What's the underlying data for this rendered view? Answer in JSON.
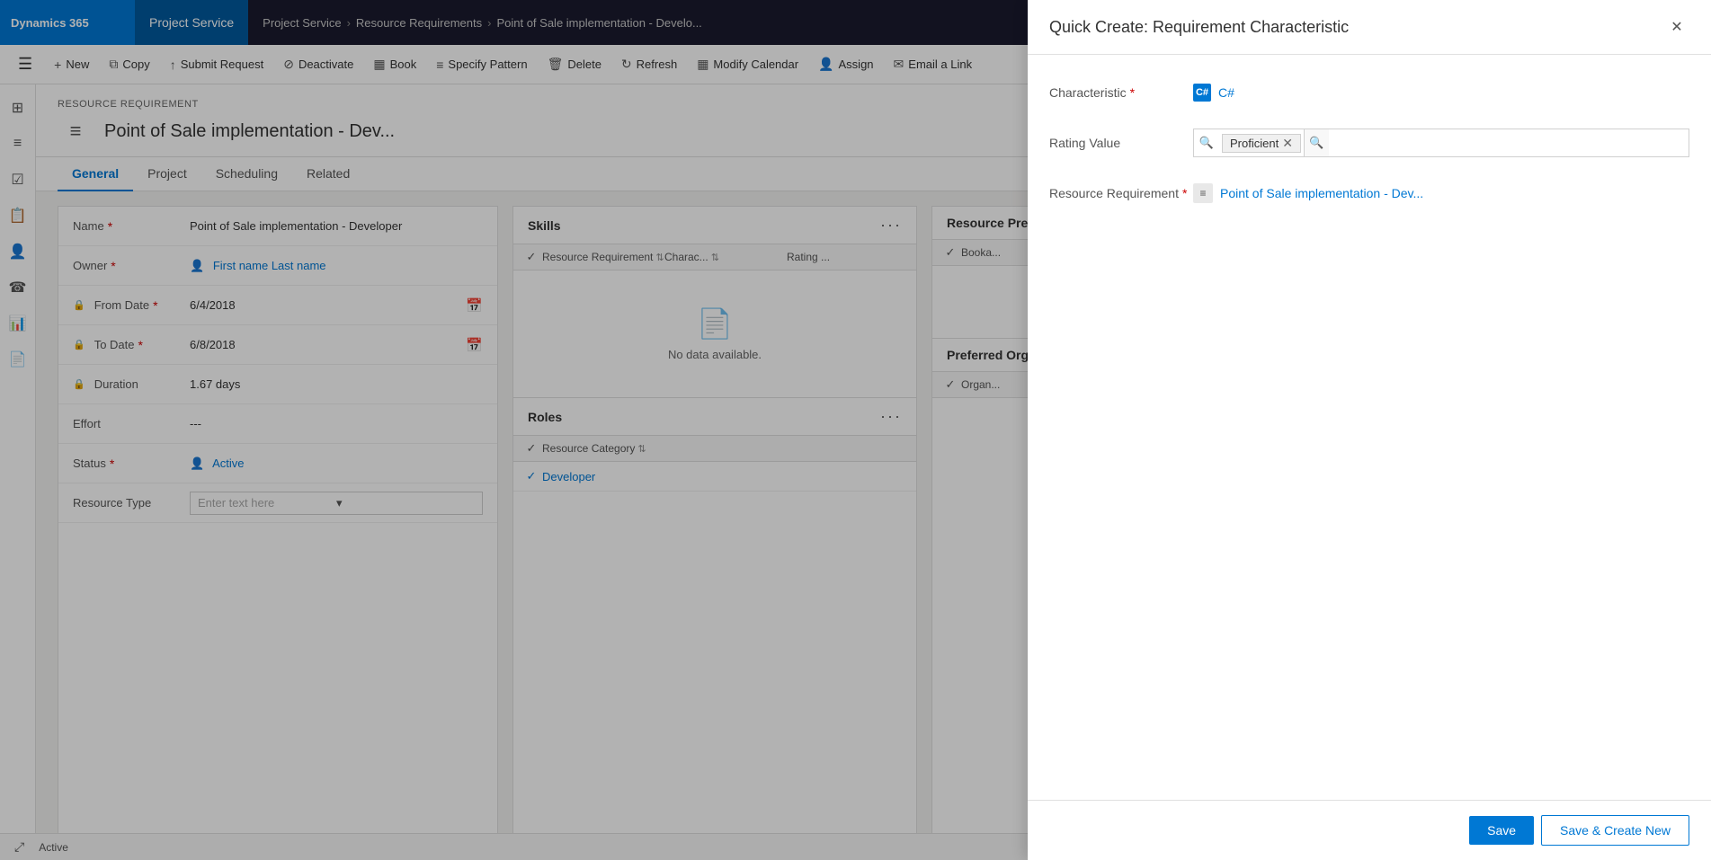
{
  "app": {
    "brand": "Dynamics 365",
    "module": "Project Service"
  },
  "breadcrumb": {
    "items": [
      "Project Service",
      "Resource Requirements",
      "Point of Sale implementation - Develo..."
    ]
  },
  "toolbar": {
    "buttons": [
      {
        "id": "new",
        "label": "New",
        "icon": "+"
      },
      {
        "id": "copy",
        "label": "Copy",
        "icon": "⧉"
      },
      {
        "id": "submit-request",
        "label": "Submit Request",
        "icon": "↑"
      },
      {
        "id": "deactivate",
        "label": "Deactivate",
        "icon": "⊘"
      },
      {
        "id": "book",
        "label": "Book",
        "icon": "▦"
      },
      {
        "id": "specify-pattern",
        "label": "Specify Pattern",
        "icon": "≡"
      },
      {
        "id": "delete",
        "label": "Delete",
        "icon": "🗑"
      },
      {
        "id": "refresh",
        "label": "Refresh",
        "icon": "↻"
      },
      {
        "id": "modify-calendar",
        "label": "Modify Calendar",
        "icon": "▦"
      },
      {
        "id": "assign",
        "label": "Assign",
        "icon": "👤"
      },
      {
        "id": "email-link",
        "label": "Email a Link",
        "icon": "✉"
      }
    ]
  },
  "record": {
    "type": "RESOURCE REQUIREMENT",
    "title": "Point of Sale implementation - Dev...",
    "tabs": [
      "General",
      "Project",
      "Scheduling",
      "Related"
    ],
    "active_tab": "General"
  },
  "form": {
    "fields": [
      {
        "label": "Name",
        "required": true,
        "value": "Point of Sale implementation - Developer",
        "type": "text"
      },
      {
        "label": "Owner",
        "required": true,
        "value": "First name Last name",
        "type": "link",
        "icon": "👤"
      },
      {
        "label": "From Date",
        "required": true,
        "value": "6/4/2018",
        "type": "date"
      },
      {
        "label": "To Date",
        "required": true,
        "value": "6/8/2018",
        "type": "date"
      },
      {
        "label": "Duration",
        "required": false,
        "value": "1.67 days",
        "type": "text"
      },
      {
        "label": "Effort",
        "required": false,
        "value": "---",
        "type": "text"
      },
      {
        "label": "Status",
        "required": true,
        "value": "Active",
        "type": "link",
        "icon": "👤"
      },
      {
        "label": "Resource Type",
        "required": false,
        "value": "",
        "placeholder": "Enter text here",
        "type": "dropdown"
      }
    ]
  },
  "skills_grid": {
    "title": "Skills",
    "columns": [
      "Resource Requirement",
      "Charac...",
      "Rating ..."
    ],
    "no_data_text": "No data available.",
    "rows": []
  },
  "roles_grid": {
    "title": "Roles",
    "columns": [
      "Resource Category"
    ],
    "rows": [
      {
        "value": "Developer"
      }
    ]
  },
  "resource_pref": {
    "title": "Resource Prefe...",
    "columns": [
      "Booka..."
    ]
  },
  "preferred_org": {
    "title": "Preferred Orga...",
    "columns": [
      "Organ..."
    ]
  },
  "quick_create": {
    "title": "Quick Create: Requirement Characteristic",
    "fields": {
      "characteristic": {
        "label": "Characteristic",
        "required": true,
        "value": "C#",
        "icon_text": "C#"
      },
      "rating_value": {
        "label": "Rating Value",
        "required": false,
        "value": "Proficient"
      },
      "resource_requirement": {
        "label": "Resource Requirement",
        "required": true,
        "value": "Point of Sale implementation - Dev...",
        "icon": "≡"
      }
    },
    "buttons": {
      "save": "Save",
      "save_create_new": "Save & Create New"
    }
  },
  "status_bar": {
    "status": "Active",
    "icon": "⤢"
  },
  "nav_icons": [
    "☰",
    "⊞",
    "≡",
    "📋",
    "📋",
    "👤",
    "☎",
    "📋",
    "📄"
  ]
}
